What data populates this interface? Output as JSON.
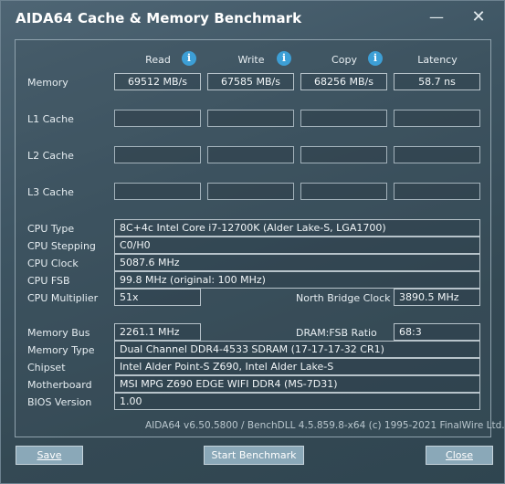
{
  "window": {
    "title": "AIDA64 Cache & Memory Benchmark",
    "minimize_glyph": "—",
    "close_glyph": "✕"
  },
  "columns": {
    "read": "Read",
    "write": "Write",
    "copy": "Copy",
    "latency": "Latency",
    "info_glyph": "i"
  },
  "rows": {
    "memory": {
      "label": "Memory",
      "read": "69512 MB/s",
      "write": "67585 MB/s",
      "copy": "68256 MB/s",
      "latency": "58.7 ns"
    },
    "l1": {
      "label": "L1 Cache",
      "read": "",
      "write": "",
      "copy": "",
      "latency": ""
    },
    "l2": {
      "label": "L2 Cache",
      "read": "",
      "write": "",
      "copy": "",
      "latency": ""
    },
    "l3": {
      "label": "L3 Cache",
      "read": "",
      "write": "",
      "copy": "",
      "latency": ""
    }
  },
  "cpu": {
    "type_label": "CPU Type",
    "type": "8C+4c Intel Core i7-12700K  (Alder Lake-S, LGA1700)",
    "stepping_label": "CPU Stepping",
    "stepping": "C0/H0",
    "clock_label": "CPU Clock",
    "clock": "5087.6 MHz",
    "fsb_label": "CPU FSB",
    "fsb": "99.8 MHz  (original: 100 MHz)",
    "multiplier_label": "CPU Multiplier",
    "multiplier": "51x",
    "nb_clock_label": "North Bridge Clock",
    "nb_clock": "3890.5 MHz"
  },
  "memory_info": {
    "bus_label": "Memory Bus",
    "bus": "2261.1 MHz",
    "ratio_label": "DRAM:FSB Ratio",
    "ratio": "68:3",
    "type_label": "Memory Type",
    "type": "Dual Channel DDR4-4533 SDRAM  (17-17-17-32 CR1)",
    "chipset_label": "Chipset",
    "chipset": "Intel Alder Point-S Z690, Intel Alder Lake-S",
    "motherboard_label": "Motherboard",
    "motherboard": "MSI MPG Z690 EDGE WIFI DDR4 (MS-7D31)",
    "bios_label": "BIOS Version",
    "bios": "1.00"
  },
  "footer": "AIDA64 v6.50.5800 / BenchDLL 4.5.859.8-x64  (c) 1995-2021 FinalWire Ltd.",
  "buttons": {
    "save": "Save",
    "start": "Start Benchmark",
    "close": "Close"
  }
}
